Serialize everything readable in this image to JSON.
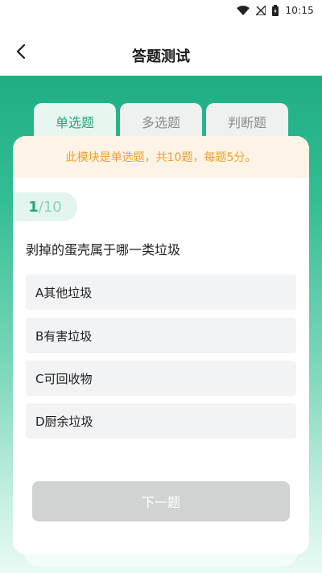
{
  "status_bar": {
    "time": "10:15",
    "icons": [
      "wifi-icon",
      "no-signal-icon",
      "battery-icon"
    ]
  },
  "header": {
    "back_icon": "chevron-left-icon",
    "title": "答题测试"
  },
  "tabs": [
    {
      "label": "单选题",
      "active": true
    },
    {
      "label": "多选题",
      "active": false
    },
    {
      "label": "判断题",
      "active": false
    }
  ],
  "notice": "此模块是单选题，共10题，每题5分。",
  "progress": {
    "current": "1",
    "separator": "/",
    "total": "10"
  },
  "question": {
    "text": "剥掉的蛋壳属于哪一类垃圾",
    "options": [
      "A其他垃圾",
      "B有害垃圾",
      "C可回收物",
      "D厨余垃圾"
    ]
  },
  "next_button_label": "下一题",
  "colors": {
    "accent": "#22a87d",
    "notice_text": "#f2a123",
    "notice_bg": "#fdf3e7",
    "button_disabled": "#cfd4d2"
  }
}
